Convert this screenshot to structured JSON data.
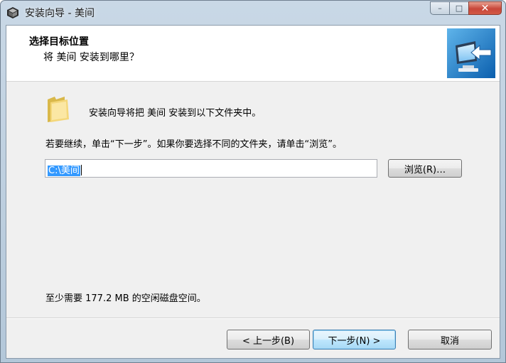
{
  "window": {
    "title": "安装向导 - 美间",
    "caption": {
      "minimize": "–",
      "maximize": "□",
      "close": "✕"
    }
  },
  "header": {
    "title": "选择目标位置",
    "subtitle": "将 美间 安装到哪里？",
    "image_icon": "monitor-arrow-icon"
  },
  "body": {
    "intro": "安装向导将把 美间 安装到以下文件夹中。",
    "instruction": "若要继续，单击“下一步”。如果你要选择不同的文件夹，请单击“浏览”。",
    "path_value": "C:\\美间",
    "browse_label": "浏览(R)…",
    "space_required": "至少需要 177.2 MB 的空闲磁盘空间。"
  },
  "footer": {
    "back_label": "< 上一步(B)",
    "next_label": "下一步(N) >",
    "cancel_label": "取消"
  },
  "colors": {
    "selection": "#3399ff",
    "next_button_border": "#3c7fb1",
    "close_button": "#c8473a"
  }
}
